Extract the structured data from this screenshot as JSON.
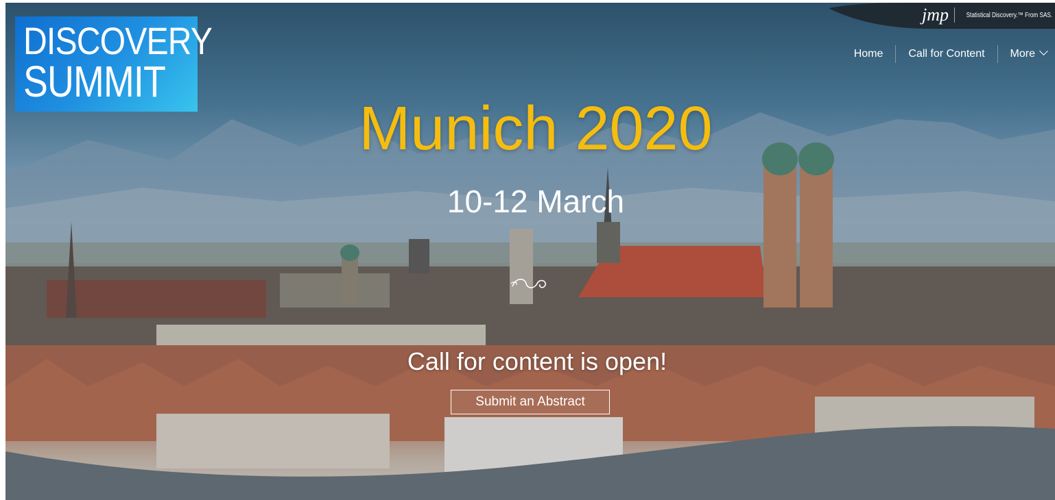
{
  "logo": {
    "line1": "DISCOVERY",
    "line2": "SUMMIT"
  },
  "brand": {
    "jmp_logo_text": "jmp",
    "tagline": "Statistical Discovery.™ From SAS."
  },
  "nav": {
    "items": [
      "Home",
      "Call for Content",
      "More"
    ]
  },
  "hero": {
    "title": "Munich 2020",
    "dates": "10-12 March",
    "call_text": "Call for content is open!",
    "button_label": "Submit an Abstract"
  },
  "colors": {
    "title": "#f5bd0f",
    "wave": "#5d6870",
    "logo_blue": "#1f8fe0",
    "brand_bar": "#1f2a33"
  },
  "icons": [
    "chevron-down-icon",
    "flourish-icon"
  ]
}
